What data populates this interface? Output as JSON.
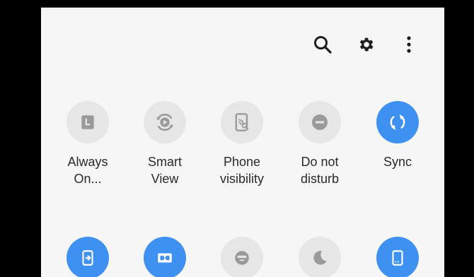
{
  "toolbar": {
    "search_icon": "search-icon",
    "settings_icon": "gear-icon",
    "more_icon": "more-vertical-icon"
  },
  "colors": {
    "accent": "#3e91f0",
    "tile_off": "#e6e6e6",
    "icon_off": "#9a9a9a",
    "background": "#f6f6f6"
  },
  "tiles_row1": [
    {
      "label": "Always\nOn...",
      "icon": "always-on-display-icon",
      "state": "off"
    },
    {
      "label": "Smart\nView",
      "icon": "smart-view-icon",
      "state": "off"
    },
    {
      "label": "Phone\nvisibility",
      "icon": "phone-visibility-icon",
      "state": "off"
    },
    {
      "label": "Do not\ndisturb",
      "icon": "do-not-disturb-icon",
      "state": "off"
    },
    {
      "label": "Sync",
      "icon": "sync-icon",
      "state": "on"
    }
  ],
  "tiles_row2": [
    {
      "icon": "secure-folder-icon",
      "state": "on"
    },
    {
      "icon": "dolby-atmos-icon",
      "state": "on"
    },
    {
      "icon": "kids-mode-icon",
      "state": "off"
    },
    {
      "icon": "night-mode-icon",
      "state": "off"
    },
    {
      "icon": "screen-icon",
      "state": "on"
    }
  ]
}
